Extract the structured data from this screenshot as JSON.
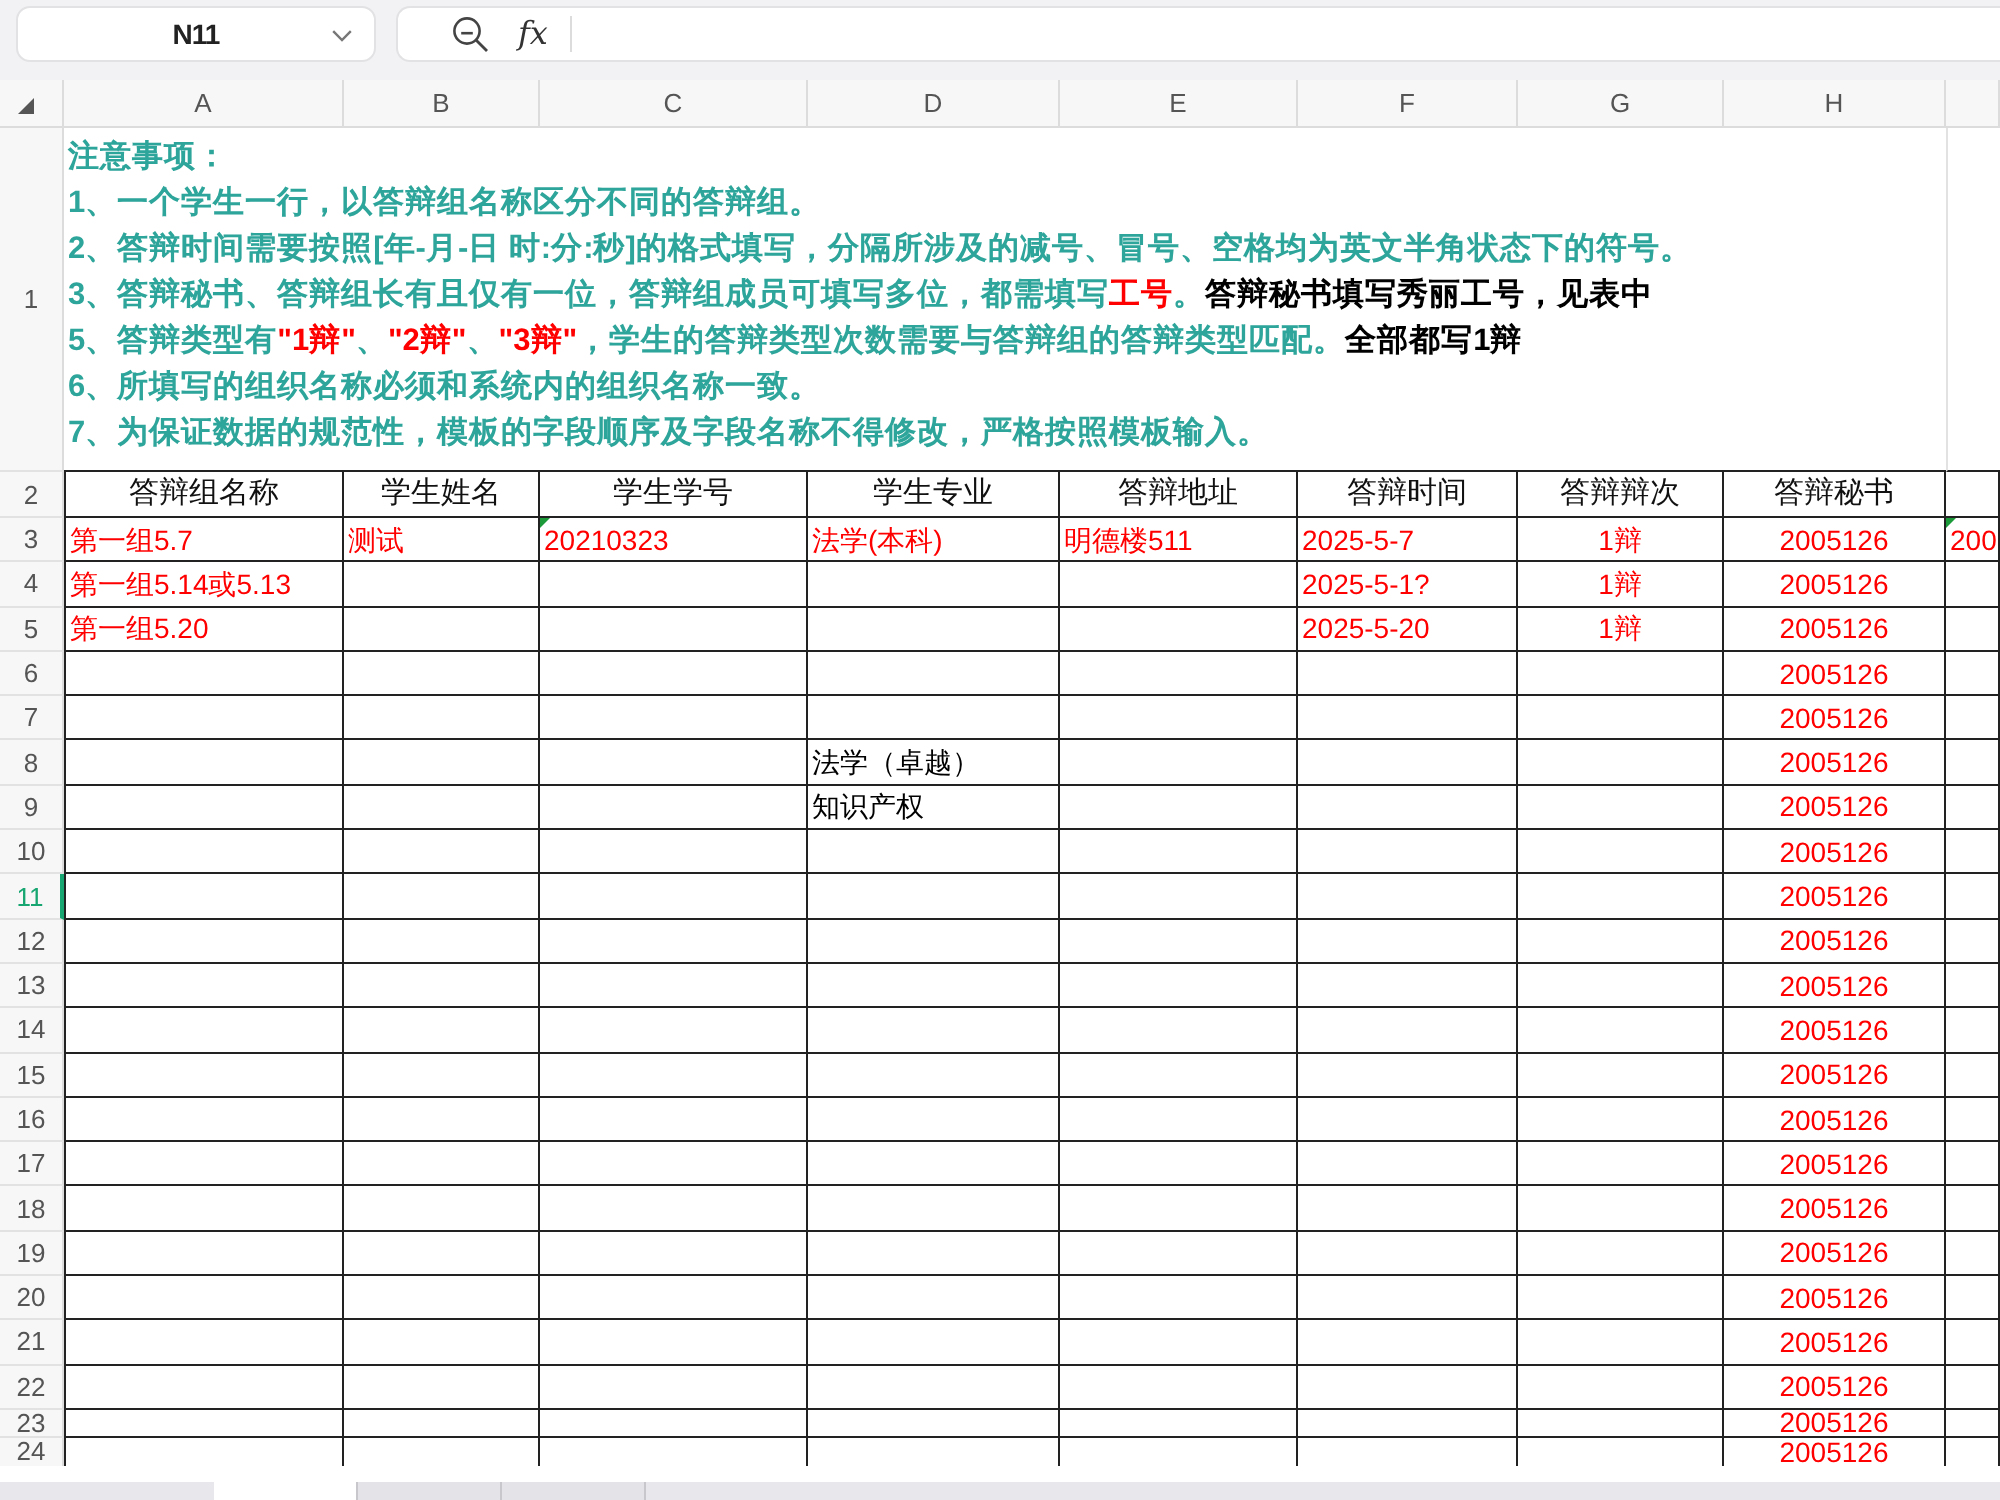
{
  "name_box": {
    "value": "N11"
  },
  "formula_bar": {
    "function_label": "fx"
  },
  "columns": [
    {
      "label": "A",
      "selected": false
    },
    {
      "label": "B",
      "selected": false
    },
    {
      "label": "C",
      "selected": false
    },
    {
      "label": "D",
      "selected": false
    },
    {
      "label": "E",
      "selected": false
    },
    {
      "label": "F",
      "selected": false
    },
    {
      "label": "G",
      "selected": false
    },
    {
      "label": "H",
      "selected": false
    }
  ],
  "notes": {
    "row_number": "1",
    "selected": false,
    "lines": [
      [
        {
          "kind": "note",
          "text": "注意事项："
        }
      ],
      [
        {
          "kind": "note",
          "text": "1、一个学生一行，以答辩组名称区分不同的答辩组。"
        }
      ],
      [
        {
          "kind": "note",
          "text": "2、答辩时间需要按照[年-月-日 时:分:秒]的格式填写，分隔所涉及的减号、冒号、空格均为英文半角状态下的符号。"
        }
      ],
      [
        {
          "kind": "note",
          "text": "3、答辩秘书、答辩组长有且仅有一位，答辩组成员可填写多位，都需填写"
        },
        {
          "kind": "warning",
          "text": "工号"
        },
        {
          "kind": "note",
          "text": "。"
        },
        {
          "kind": "comment",
          "text": "答辩秘书填写秀丽工号，见表中"
        }
      ],
      [
        {
          "kind": "note",
          "text": "5、答辩类型有"
        },
        {
          "kind": "warning",
          "text": "\"1辩\""
        },
        {
          "kind": "note",
          "text": "、"
        },
        {
          "kind": "warning",
          "text": "\"2辩\""
        },
        {
          "kind": "note",
          "text": "、"
        },
        {
          "kind": "warning",
          "text": "\"3辩\""
        },
        {
          "kind": "note",
          "text": "，学生的答辩类型次数需要与答辩组的答辩类型匹配。"
        },
        {
          "kind": "comment",
          "text": "全部都写1辩"
        }
      ],
      [
        {
          "kind": "note",
          "text": "6、所填写的组织名称必须和系统内的组织名称一致。"
        }
      ],
      [
        {
          "kind": "note",
          "text": "7、为保证数据的规范性，模板的字段顺序及字段名称不得修改，严格按照模板输入。"
        }
      ]
    ]
  },
  "table": {
    "header_row": {
      "number": "2",
      "selected": false,
      "cells": [
        "答辩组名称",
        "学生姓名",
        "学生学号",
        "学生专业",
        "答辩地址",
        "答辩时间",
        "答辩辩次",
        "答辩秘书"
      ]
    },
    "rows": [
      {
        "number": "3",
        "selected": false,
        "cells": [
          {
            "text": "第一组5.7",
            "color": "#ff0000",
            "flagged": false
          },
          {
            "text": "测试",
            "color": "#ff0000",
            "flagged": false
          },
          {
            "text": "20210323",
            "color": "#ff0000",
            "flagged": true
          },
          {
            "text": "法学(本科)",
            "color": "#ff0000",
            "flagged": false
          },
          {
            "text": "明德楼511",
            "color": "#ff0000",
            "flagged": false
          },
          {
            "text": "2025-5-7",
            "color": "#ff0000",
            "flagged": false
          },
          {
            "text": "1辩",
            "color": "#ff0000",
            "flagged": false
          },
          {
            "text": "2005126",
            "color": "#ff0000",
            "flagged": false
          },
          {
            "text": "200",
            "color": "#ff0000",
            "flagged": true
          }
        ]
      },
      {
        "number": "4",
        "selected": false,
        "cells": [
          {
            "text": "第一组5.14或5.13",
            "color": "#ff0000",
            "flagged": false
          },
          null,
          null,
          null,
          null,
          {
            "text": "2025-5-1?",
            "color": "#ff0000",
            "flagged": false
          },
          {
            "text": "1辩",
            "color": "#ff0000",
            "flagged": false
          },
          {
            "text": "2005126",
            "color": "#ff0000",
            "flagged": false
          }
        ]
      },
      {
        "number": "5",
        "selected": false,
        "cells": [
          {
            "text": "第一组5.20",
            "color": "#ff0000",
            "flagged": false
          },
          null,
          null,
          null,
          null,
          {
            "text": "2025-5-20",
            "color": "#ff0000",
            "flagged": false
          },
          {
            "text": "1辩",
            "color": "#ff0000",
            "flagged": false
          },
          {
            "text": "2005126",
            "color": "#ff0000",
            "flagged": false
          }
        ]
      },
      {
        "number": "6",
        "selected": false,
        "cells": [
          null,
          null,
          null,
          null,
          null,
          null,
          null,
          {
            "text": "2005126",
            "color": "#ff0000",
            "flagged": false
          }
        ]
      },
      {
        "number": "7",
        "selected": false,
        "cells": [
          null,
          null,
          null,
          null,
          null,
          null,
          null,
          {
            "text": "2005126",
            "color": "#ff0000",
            "flagged": false
          }
        ]
      },
      {
        "number": "8",
        "selected": false,
        "cells": [
          null,
          null,
          null,
          {
            "text": "法学（卓越）",
            "color": "#000000",
            "flagged": false
          },
          null,
          null,
          null,
          {
            "text": "2005126",
            "color": "#ff0000",
            "flagged": false
          }
        ]
      },
      {
        "number": "9",
        "selected": false,
        "cells": [
          null,
          null,
          null,
          {
            "text": "知识产权",
            "color": "#000000",
            "flagged": false
          },
          null,
          null,
          null,
          {
            "text": "2005126",
            "color": "#ff0000",
            "flagged": false
          }
        ]
      },
      {
        "number": "10",
        "selected": false,
        "cells": [
          null,
          null,
          null,
          null,
          null,
          null,
          null,
          {
            "text": "2005126",
            "color": "#ff0000",
            "flagged": false
          }
        ]
      },
      {
        "number": "11",
        "selected": true,
        "cells": [
          null,
          null,
          null,
          null,
          null,
          null,
          null,
          {
            "text": "2005126",
            "color": "#ff0000",
            "flagged": false
          }
        ]
      },
      {
        "number": "12",
        "selected": false,
        "cells": [
          null,
          null,
          null,
          null,
          null,
          null,
          null,
          {
            "text": "2005126",
            "color": "#ff0000",
            "flagged": false
          }
        ]
      },
      {
        "number": "13",
        "selected": false,
        "cells": [
          null,
          null,
          null,
          null,
          null,
          null,
          null,
          {
            "text": "2005126",
            "color": "#ff0000",
            "flagged": false
          }
        ]
      },
      {
        "number": "14",
        "selected": false,
        "cells": [
          null,
          null,
          null,
          null,
          null,
          null,
          null,
          {
            "text": "2005126",
            "color": "#ff0000",
            "flagged": false
          }
        ]
      },
      {
        "number": "15",
        "selected": false,
        "cells": [
          null,
          null,
          null,
          null,
          null,
          null,
          null,
          {
            "text": "2005126",
            "color": "#ff0000",
            "flagged": false
          }
        ]
      },
      {
        "number": "16",
        "selected": false,
        "cells": [
          null,
          null,
          null,
          null,
          null,
          null,
          null,
          {
            "text": "2005126",
            "color": "#ff0000",
            "flagged": false
          }
        ]
      },
      {
        "number": "17",
        "selected": false,
        "cells": [
          null,
          null,
          null,
          null,
          null,
          null,
          null,
          {
            "text": "2005126",
            "color": "#ff0000",
            "flagged": false
          }
        ]
      },
      {
        "number": "18",
        "selected": false,
        "cells": [
          null,
          null,
          null,
          null,
          null,
          null,
          null,
          {
            "text": "2005126",
            "color": "#ff0000",
            "flagged": false
          }
        ]
      },
      {
        "number": "19",
        "selected": false,
        "cells": [
          null,
          null,
          null,
          null,
          null,
          null,
          null,
          {
            "text": "2005126",
            "color": "#ff0000",
            "flagged": false
          }
        ]
      },
      {
        "number": "20",
        "selected": false,
        "cells": [
          null,
          null,
          null,
          null,
          null,
          null,
          null,
          {
            "text": "2005126",
            "color": "#ff0000",
            "flagged": false
          }
        ]
      },
      {
        "number": "21",
        "selected": false,
        "cells": [
          null,
          null,
          null,
          null,
          null,
          null,
          null,
          {
            "text": "2005126",
            "color": "#ff0000",
            "flagged": false
          }
        ]
      },
      {
        "number": "22",
        "selected": false,
        "cells": [
          null,
          null,
          null,
          null,
          null,
          null,
          null,
          {
            "text": "2005126",
            "color": "#ff0000",
            "flagged": false
          }
        ]
      },
      {
        "number": "23",
        "selected": false,
        "cells": [
          null,
          null,
          null,
          null,
          null,
          null,
          null,
          {
            "text": "2005126",
            "color": "#ff0000",
            "flagged": false
          }
        ]
      },
      {
        "number": "24",
        "selected": false,
        "cells": [
          null,
          null,
          null,
          null,
          null,
          null,
          null,
          {
            "text": "2005126",
            "color": "#ff0000",
            "flagged": false
          }
        ]
      }
    ]
  },
  "sheet_tabs": [
    {
      "selected": true
    },
    {
      "selected": false
    },
    {
      "selected": false
    }
  ]
}
